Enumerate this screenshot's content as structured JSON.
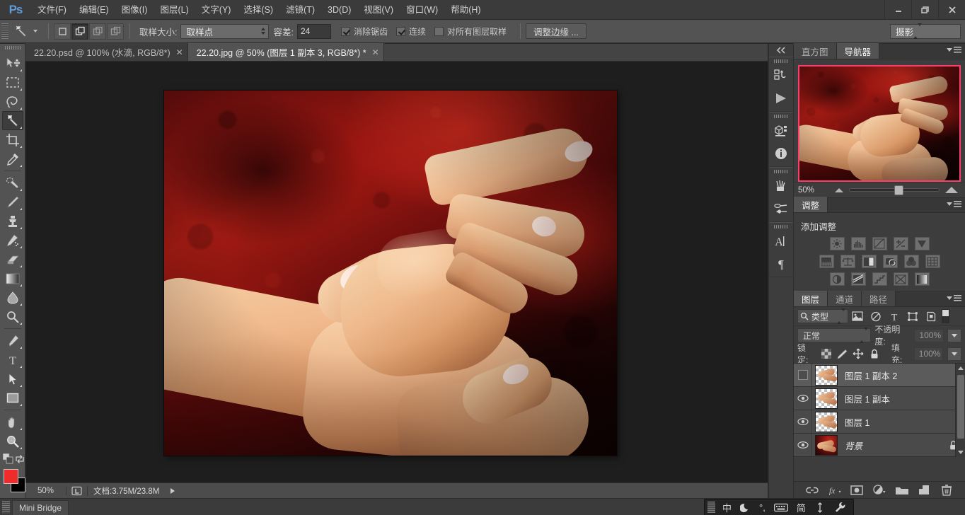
{
  "app": {
    "name": "Ps",
    "logo_color": "#5f9cd8"
  },
  "menubar": {
    "items": [
      {
        "label": "文件(F)",
        "name": "menu-file"
      },
      {
        "label": "编辑(E)",
        "name": "menu-edit"
      },
      {
        "label": "图像(I)",
        "name": "menu-image"
      },
      {
        "label": "图层(L)",
        "name": "menu-layer"
      },
      {
        "label": "文字(Y)",
        "name": "menu-type"
      },
      {
        "label": "选择(S)",
        "name": "menu-select"
      },
      {
        "label": "滤镜(T)",
        "name": "menu-filter"
      },
      {
        "label": "3D(D)",
        "name": "menu-3d"
      },
      {
        "label": "视图(V)",
        "name": "menu-view"
      },
      {
        "label": "窗口(W)",
        "name": "menu-window"
      },
      {
        "label": "帮助(H)",
        "name": "menu-help"
      }
    ],
    "window_buttons": {
      "minimize": "—",
      "restore": "❐",
      "close": "✕"
    }
  },
  "options_bar": {
    "tool_icon": "magic-wand-icon",
    "selection_modes": [
      "new-selection",
      "add-to-selection",
      "subtract-from-selection",
      "intersect-selection"
    ],
    "active_mode_index": 1,
    "sample_size_label": "取样大小:",
    "sample_size_value": "取样点",
    "tolerance_label": "容差:",
    "tolerance_value": "24",
    "antialias_label": "消除锯齿",
    "antialias_checked": true,
    "contiguous_label": "连续",
    "contiguous_checked": true,
    "sample_all_layers_label": "对所有图层取样",
    "sample_all_layers_checked": false,
    "refine_edge_label": "调整边缘 ...",
    "workspace_value": "摄影"
  },
  "toolbar": {
    "tools": [
      {
        "name": "move-tool",
        "icon": "move-icon"
      },
      {
        "name": "rectangular-marquee-tool",
        "icon": "marquee-icon"
      },
      {
        "name": "lasso-tool",
        "icon": "lasso-icon"
      },
      {
        "name": "magic-wand-tool",
        "icon": "magic-wand-icon",
        "selected": true
      },
      {
        "name": "crop-tool",
        "icon": "crop-icon"
      },
      {
        "name": "eyedropper-tool",
        "icon": "eyedropper-icon"
      },
      {
        "name": "spot-healing-brush-tool",
        "icon": "healing-brush-icon"
      },
      {
        "name": "brush-tool",
        "icon": "brush-icon"
      },
      {
        "name": "clone-stamp-tool",
        "icon": "clone-stamp-icon"
      },
      {
        "name": "history-brush-tool",
        "icon": "history-brush-icon"
      },
      {
        "name": "eraser-tool",
        "icon": "eraser-icon"
      },
      {
        "name": "gradient-tool",
        "icon": "gradient-icon"
      },
      {
        "name": "blur-tool",
        "icon": "blur-drop-icon"
      },
      {
        "name": "dodge-tool",
        "icon": "dodge-icon"
      },
      {
        "name": "pen-tool",
        "icon": "pen-icon"
      },
      {
        "name": "horizontal-type-tool",
        "icon": "type-icon"
      },
      {
        "name": "path-selection-tool",
        "icon": "path-arrow-icon"
      },
      {
        "name": "rectangle-tool",
        "icon": "rectangle-icon"
      },
      {
        "name": "hand-tool",
        "icon": "hand-icon"
      },
      {
        "name": "zoom-tool",
        "icon": "zoom-icon"
      }
    ],
    "foreground_color": "#f02b2b",
    "background_color": "#000000",
    "quick_mask_icon": "quick-mask-icon"
  },
  "document_tabs": [
    {
      "label": "22.20.psd @ 100% (水滴, RGB/8*)",
      "active": false,
      "close": "✕"
    },
    {
      "label": "22.20.jpg @ 50% (图层 1 副本 3, RGB/8*) *",
      "active": true,
      "close": "✕"
    }
  ],
  "status_bar": {
    "zoom": "50%",
    "icon": "doc-size-icon",
    "doc_info": "文档:3.75M/23.8M"
  },
  "bottom_bar": {
    "mini_bridge_label": "Mini Bridge",
    "ime": {
      "items": [
        "中",
        "☽",
        "°,",
        "⌨",
        "简",
        "⇕",
        "🔧"
      ]
    }
  },
  "rail": {
    "collapse_icon": "collapse-panels-icon",
    "groups": [
      {
        "icons": [
          {
            "name": "history-panel-icon"
          },
          {
            "name": "actions-panel-icon"
          }
        ]
      },
      {
        "icons": [
          {
            "name": "3d-panel-icon"
          },
          {
            "name": "info-panel-icon"
          }
        ]
      },
      {
        "icons": [
          {
            "name": "brush-presets-panel-icon"
          },
          {
            "name": "tool-presets-panel-icon"
          }
        ]
      },
      {
        "icons": [
          {
            "name": "character-panel-icon"
          },
          {
            "name": "paragraph-panel-icon"
          }
        ]
      }
    ]
  },
  "navigator_panel": {
    "tabs": [
      {
        "label": "直方图",
        "active": false
      },
      {
        "label": "导航器",
        "active": true
      }
    ],
    "menu_icon": "panel-menu-icon",
    "zoom_value": "50%",
    "view_rect_color": "#ff3c6e",
    "zoom_out_icon": "zoom-out-icon",
    "zoom_in_icon": "zoom-in-icon"
  },
  "adjustments_panel": {
    "tabs": [
      {
        "label": "调整",
        "active": true
      }
    ],
    "menu_icon": "panel-menu-icon",
    "title": "添加调整",
    "rows": [
      [
        "brightness-contrast-icon",
        "levels-icon",
        "curves-icon",
        "exposure-icon",
        "vibrance-icon"
      ],
      [
        "hue-saturation-icon",
        "color-balance-icon",
        "black-white-icon",
        "photo-filter-icon",
        "channel-mixer-icon",
        "color-lookup-icon"
      ],
      [
        "invert-icon",
        "posterize-icon",
        "threshold-icon",
        "selective-color-icon",
        "gradient-map-icon"
      ]
    ]
  },
  "layers_panel": {
    "tabs": [
      {
        "label": "图层",
        "active": true
      },
      {
        "label": "通道",
        "active": false
      },
      {
        "label": "路径",
        "active": false
      }
    ],
    "menu_icon": "panel-menu-icon",
    "filter": {
      "search_icon": "search-icon",
      "kind_value": "类型",
      "icons": [
        "filter-pixel-icon",
        "filter-adjustment-icon",
        "filter-type-icon",
        "filter-shape-icon",
        "filter-smartobject-icon"
      ],
      "toggle_name": "filter-enable-toggle"
    },
    "blend_mode": "正常",
    "opacity_label": "不透明度:",
    "opacity_value": "100%",
    "lock_label": "锁定:",
    "lock_icons": [
      "lock-transparent-icon",
      "lock-image-icon",
      "lock-position-icon",
      "lock-all-icon"
    ],
    "fill_label": "填充:",
    "fill_value": "100%",
    "layers": [
      {
        "name": "图层 1 副本 2",
        "visible": false,
        "selected": true,
        "thumb": "transparent",
        "locked": false
      },
      {
        "name": "图层 1 副本",
        "visible": true,
        "selected": false,
        "thumb": "transparent",
        "locked": false
      },
      {
        "name": "图层 1",
        "visible": true,
        "selected": false,
        "thumb": "transparent",
        "locked": false
      },
      {
        "name": "背景",
        "visible": true,
        "selected": false,
        "thumb": "photo",
        "locked": true,
        "italic": true
      }
    ],
    "footer_buttons": [
      {
        "name": "link-layers-button",
        "icon": "link-icon"
      },
      {
        "name": "layer-style-button",
        "icon": "fx-icon"
      },
      {
        "name": "add-mask-button",
        "icon": "mask-icon"
      },
      {
        "name": "new-adjustment-layer-button",
        "icon": "half-circle-icon"
      },
      {
        "name": "new-group-button",
        "icon": "folder-icon"
      },
      {
        "name": "new-layer-button",
        "icon": "new-layer-icon"
      },
      {
        "name": "delete-layer-button",
        "icon": "trash-icon"
      }
    ]
  },
  "canvas": {
    "image_title": "hands-on-red-background",
    "zoom": "50%"
  }
}
